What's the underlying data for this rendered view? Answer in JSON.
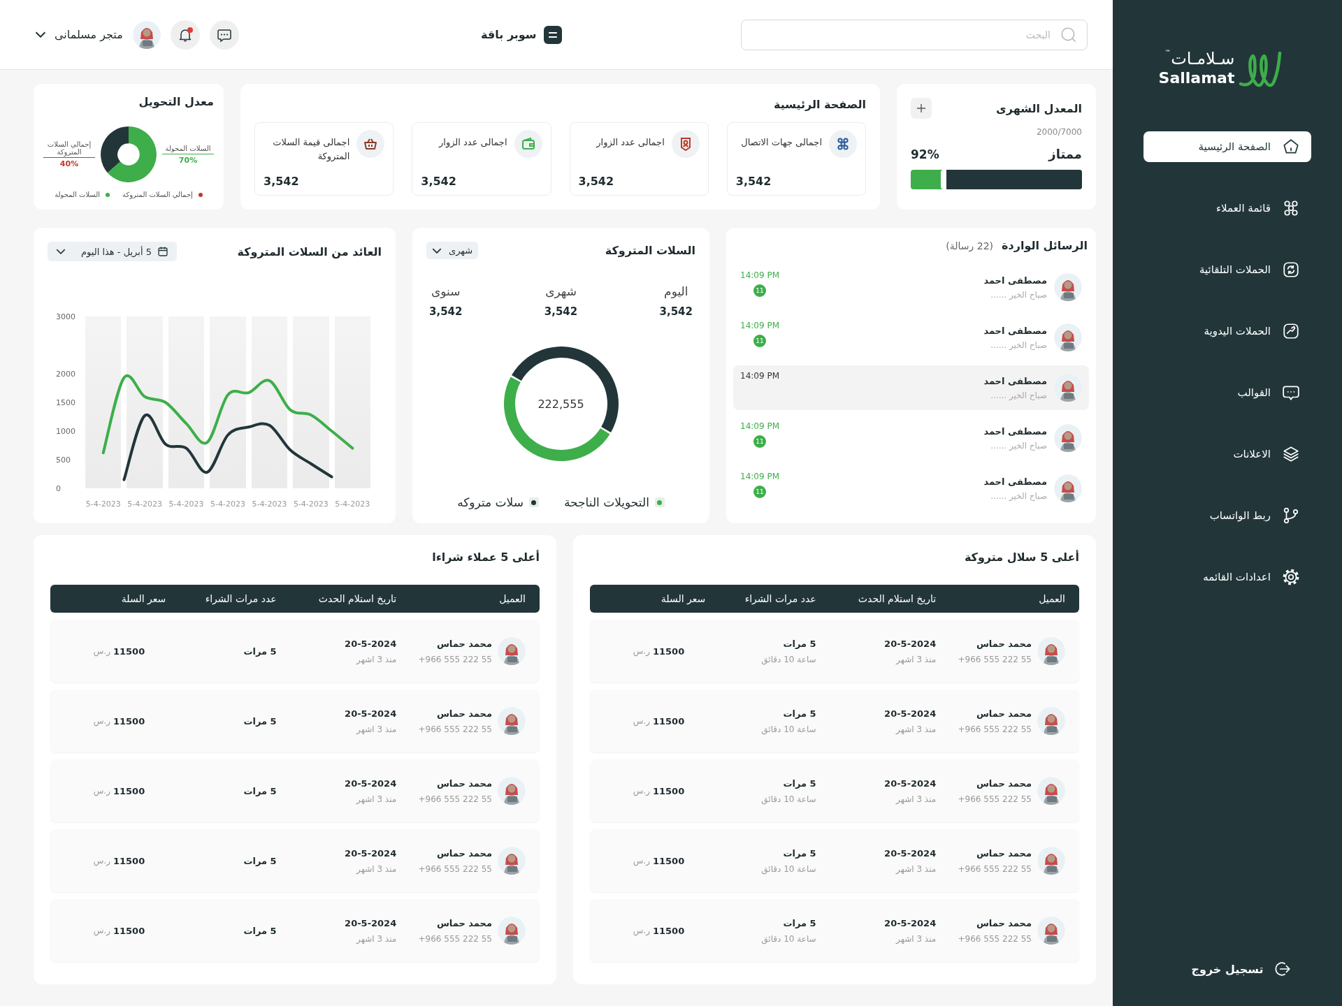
{
  "sidebar": {
    "logo": {
      "arabic": "سـلامـات",
      "latin": "Sallamat",
      "mark": "™"
    },
    "items": [
      {
        "label": "الصفحة الرئيسية",
        "selected": true
      },
      {
        "label": "قائمة العملاء",
        "selected": false
      },
      {
        "label": "الحملات التلقائية",
        "selected": false
      },
      {
        "label": "الحملات اليدوية",
        "selected": false
      },
      {
        "label": "القوالب",
        "selected": false
      },
      {
        "label": "الاعلانات",
        "selected": false
      },
      {
        "label": "ربط الواتساب",
        "selected": false
      },
      {
        "label": "اعدادات القائمه",
        "selected": false
      }
    ],
    "logout": "تسجيل خروج"
  },
  "topbar": {
    "search": {
      "placeholder": "البحث"
    },
    "plan": "سوبر باقة",
    "alert": true,
    "store": "متجر مسلمانى"
  },
  "monthly": {
    "title": "المعدل الشهرى",
    "ratio": "2000/7000",
    "rating": "ممتاز",
    "percent": "92%",
    "level": 0.79
  },
  "home": {
    "title": "الصفحة الرئيسية",
    "stats": [
      {
        "label": "اجمالى جهات الاتصال",
        "value": "3,542",
        "color": "#2d5a9b"
      },
      {
        "label": "اجمالى عدد الزوار",
        "value": "3,542",
        "color": "#c0392b"
      },
      {
        "label": "اجمالى عدد الزوار",
        "value": "3,542",
        "color": "#3dae4a"
      },
      {
        "label": "اجمالى قيمة السلات المتروكة",
        "value": "3,542",
        "color": "#8b3a2a"
      }
    ]
  },
  "conversion": {
    "title": "معدل التحويل",
    "chart_data": {
      "type": "donut",
      "categories": [
        "السلات المحولة",
        "إجمالي السلات المتروكة"
      ],
      "values": [
        70,
        40
      ],
      "value_labels": [
        "70%",
        "40%"
      ]
    },
    "legend": [
      {
        "label": "إجمالي السلات المتروكة",
        "color": "#c0392b"
      },
      {
        "label": "السلات المحولة",
        "color": "#3dae4a"
      }
    ]
  },
  "messages": {
    "title": "الرسائل الواردة",
    "count": "(22 رسالة)",
    "items": [
      {
        "name": "مصطفى احمد",
        "preview": "صباح الخير ......",
        "time": "14:09 PM",
        "badge": "11",
        "selected": false
      },
      {
        "name": "مصطفى احمد",
        "preview": "صباح الخير ......",
        "time": "14:09 PM",
        "badge": "11",
        "selected": false
      },
      {
        "name": "مصطفى احمد",
        "preview": "صباح الخير ......",
        "time": "14:09 PM",
        "selected": true
      },
      {
        "name": "مصطفى احمد",
        "preview": "صباح الخير ......",
        "time": "14:09 PM",
        "badge": "11",
        "selected": false
      },
      {
        "name": "مصطفى احمد",
        "preview": "صباح الخير ......",
        "time": "14:09 PM",
        "badge": "11",
        "selected": false
      }
    ]
  },
  "abandoned": {
    "title": "السلات المتروكة",
    "period": "شهرى",
    "stats": [
      {
        "label": "اليوم",
        "value": "3,542"
      },
      {
        "label": "شهرى",
        "value": "3,542"
      },
      {
        "label": "سنوى",
        "value": "3,542"
      }
    ],
    "total": "222,555",
    "legend": [
      {
        "label": "التحويلات الناجحة",
        "color": "#3dae4a"
      },
      {
        "label": "سلات متروكه",
        "color": "#22363a"
      }
    ]
  },
  "revenue": {
    "title": "العائد من السلات المتروكة",
    "date": "5 أبريل - هذا اليوم",
    "chart_data": {
      "type": "line",
      "categories": [
        "5-4-2023",
        null,
        "5-4-2023",
        null,
        "5-4-2023",
        null,
        "5-4-2023",
        null,
        "5-4-2023",
        null,
        "5-4-2023",
        null,
        "5-4-2023"
      ],
      "yticks": [
        0,
        500,
        1000,
        1500,
        2000,
        3000
      ],
      "ylim": [
        0,
        3000
      ],
      "series": [
        {
          "color": "#3dae4a",
          "values": [
            620,
            1930,
            1600,
            1500,
            1130,
            800,
            1630,
            1670,
            1880,
            1370,
            1280,
            1000,
            700
          ]
        },
        {
          "color": "#22363a",
          "values": [
            null,
            150,
            1270,
            770,
            700,
            280,
            930,
            1070,
            1100,
            670,
            430,
            200,
            null
          ]
        }
      ]
    }
  },
  "tables": [
    {
      "title": "أعلى 5 سلال متروكة",
      "columns": [
        "العميل",
        "تاريخ استلام الحدث",
        "عدد مرات الشراء",
        "سعر السلة"
      ],
      "rows": [
        {
          "name": "محمد حماس",
          "phone": "+966 555 222 55",
          "date": "20-5-2024",
          "ago": "منذ 3 اشهر",
          "count": "5 مرات",
          "duration": "ساعة 10 دقائق",
          "price": "11500",
          "currency": "ر.س"
        },
        {
          "name": "محمد حماس",
          "phone": "+966 555 222 55",
          "date": "20-5-2024",
          "ago": "منذ 3 اشهر",
          "count": "5 مرات",
          "duration": "ساعة 10 دقائق",
          "price": "11500",
          "currency": "ر.س"
        },
        {
          "name": "محمد حماس",
          "phone": "+966 555 222 55",
          "date": "20-5-2024",
          "ago": "منذ 3 اشهر",
          "count": "5 مرات",
          "duration": "ساعة 10 دقائق",
          "price": "11500",
          "currency": "ر.س"
        },
        {
          "name": "محمد حماس",
          "phone": "+966 555 222 55",
          "date": "20-5-2024",
          "ago": "منذ 3 اشهر",
          "count": "5 مرات",
          "duration": "ساعة 10 دقائق",
          "price": "11500",
          "currency": "ر.س"
        },
        {
          "name": "محمد حماس",
          "phone": "+966 555 222 55",
          "date": "20-5-2024",
          "ago": "منذ 3 اشهر",
          "count": "5 مرات",
          "duration": "ساعة 10 دقائق",
          "price": "11500",
          "currency": "ر.س"
        }
      ]
    },
    {
      "title": "أعلى 5 عملاء شراءا",
      "columns": [
        "العميل",
        "تاريخ استلام الحدث",
        "عدد مرات الشراء",
        "سعر السلة"
      ],
      "rows": [
        {
          "name": "محمد حماس",
          "phone": "+966 555 222 55",
          "date": "20-5-2024",
          "ago": "منذ 3 اشهر",
          "count": "5 مرات",
          "price": "11500",
          "currency": "ر.س"
        },
        {
          "name": "محمد حماس",
          "phone": "+966 555 222 55",
          "date": "20-5-2024",
          "ago": "منذ 3 اشهر",
          "count": "5 مرات",
          "price": "11500",
          "currency": "ر.س"
        },
        {
          "name": "محمد حماس",
          "phone": "+966 555 222 55",
          "date": "20-5-2024",
          "ago": "منذ 3 اشهر",
          "count": "5 مرات",
          "price": "11500",
          "currency": "ر.س"
        },
        {
          "name": "محمد حماس",
          "phone": "+966 555 222 55",
          "date": "20-5-2024",
          "ago": "منذ 3 اشهر",
          "count": "5 مرات",
          "price": "11500",
          "currency": "ر.س"
        },
        {
          "name": "محمد حماس",
          "phone": "+966 555 222 55",
          "date": "20-5-2024",
          "ago": "منذ 3 اشهر",
          "count": "5 مرات",
          "price": "11500",
          "currency": "ر.س"
        }
      ]
    }
  ]
}
